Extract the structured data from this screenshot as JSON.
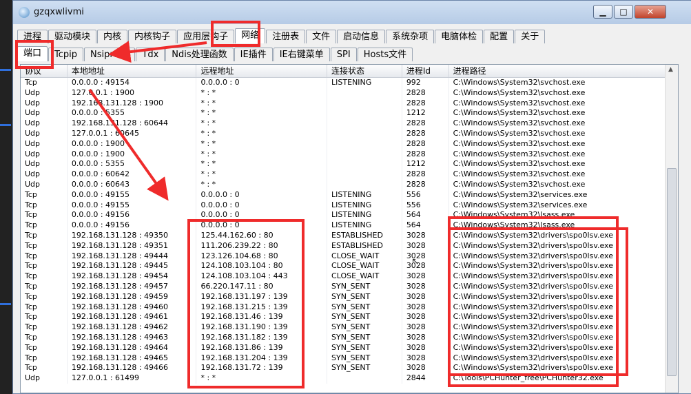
{
  "window": {
    "title": "gzqxwlivmi",
    "minimize_label": "▁",
    "maximize_label": "□",
    "close_label": "✕"
  },
  "tabs_main": [
    "进程",
    "驱动模块",
    "内核",
    "内核钩子",
    "应用层钩子",
    "网络",
    "注册表",
    "文件",
    "启动信息",
    "系统杂项",
    "电脑体检",
    "配置",
    "关于"
  ],
  "tabs_sub": [
    "端口",
    "Tcpip",
    "Nsiproxy",
    "Tdx",
    "Ndis处理函数",
    "IE插件",
    "IE右键菜单",
    "SPI",
    "Hosts文件"
  ],
  "columns": [
    "协议",
    "本地地址",
    "远程地址",
    "连接状态",
    "进程Id",
    "进程路径"
  ],
  "rows": [
    [
      "Tcp",
      "0.0.0.0 : 49154",
      "0.0.0.0 : 0",
      "LISTENING",
      "992",
      "C:\\Windows\\System32\\svchost.exe"
    ],
    [
      "Udp",
      "127.0.0.1 : 1900",
      "* : *",
      "",
      "2828",
      "C:\\Windows\\System32\\svchost.exe"
    ],
    [
      "Udp",
      "192.168.131.128 : 1900",
      "* : *",
      "",
      "2828",
      "C:\\Windows\\System32\\svchost.exe"
    ],
    [
      "Udp",
      "0.0.0.0 : 5355",
      "* : *",
      "",
      "1212",
      "C:\\Windows\\System32\\svchost.exe"
    ],
    [
      "Udp",
      "192.168.131.128 : 60644",
      "* : *",
      "",
      "2828",
      "C:\\Windows\\System32\\svchost.exe"
    ],
    [
      "Udp",
      "127.0.0.1 : 60645",
      "* : *",
      "",
      "2828",
      "C:\\Windows\\System32\\svchost.exe"
    ],
    [
      "Udp",
      "0.0.0.0 : 1900",
      "* : *",
      "",
      "2828",
      "C:\\Windows\\System32\\svchost.exe"
    ],
    [
      "Udp",
      "0.0.0.0 : 1900",
      "* : *",
      "",
      "2828",
      "C:\\Windows\\System32\\svchost.exe"
    ],
    [
      "Udp",
      "0.0.0.0 : 5355",
      "* : *",
      "",
      "1212",
      "C:\\Windows\\System32\\svchost.exe"
    ],
    [
      "Udp",
      "0.0.0.0 : 60642",
      "* : *",
      "",
      "2828",
      "C:\\Windows\\System32\\svchost.exe"
    ],
    [
      "Udp",
      "0.0.0.0 : 60643",
      "* : *",
      "",
      "2828",
      "C:\\Windows\\System32\\svchost.exe"
    ],
    [
      "Tcp",
      "0.0.0.0 : 49155",
      "0.0.0.0 : 0",
      "LISTENING",
      "556",
      "C:\\Windows\\System32\\services.exe"
    ],
    [
      "Tcp",
      "0.0.0.0 : 49155",
      "0.0.0.0 : 0",
      "LISTENING",
      "556",
      "C:\\Windows\\System32\\services.exe"
    ],
    [
      "Tcp",
      "0.0.0.0 : 49156",
      "0.0.0.0 : 0",
      "LISTENING",
      "564",
      "C:\\Windows\\System32\\lsass.exe"
    ],
    [
      "Tcp",
      "0.0.0.0 : 49156",
      "0.0.0.0 : 0",
      "LISTENING",
      "564",
      "C:\\Windows\\System32\\lsass.exe"
    ],
    [
      "Tcp",
      "192.168.131.128 : 49350",
      "125.44.162.60 : 80",
      "ESTABLISHED",
      "3028",
      "C:\\Windows\\System32\\drivers\\spo0lsv.exe"
    ],
    [
      "Tcp",
      "192.168.131.128 : 49351",
      "111.206.239.22 : 80",
      "ESTABLISHED",
      "3028",
      "C:\\Windows\\System32\\drivers\\spo0lsv.exe"
    ],
    [
      "Tcp",
      "192.168.131.128 : 49444",
      "123.126.104.68 : 80",
      "CLOSE_WAIT",
      "3028",
      "C:\\Windows\\System32\\drivers\\spo0lsv.exe"
    ],
    [
      "Tcp",
      "192.168.131.128 : 49445",
      "124.108.103.104 : 80",
      "CLOSE_WAIT",
      "3028",
      "C:\\Windows\\System32\\drivers\\spo0lsv.exe"
    ],
    [
      "Tcp",
      "192.168.131.128 : 49454",
      "124.108.103.104 : 443",
      "CLOSE_WAIT",
      "3028",
      "C:\\Windows\\System32\\drivers\\spo0lsv.exe"
    ],
    [
      "Tcp",
      "192.168.131.128 : 49457",
      "66.220.147.11 : 80",
      "SYN_SENT",
      "3028",
      "C:\\Windows\\System32\\drivers\\spo0lsv.exe"
    ],
    [
      "Tcp",
      "192.168.131.128 : 49459",
      "192.168.131.197 : 139",
      "SYN_SENT",
      "3028",
      "C:\\Windows\\System32\\drivers\\spo0lsv.exe"
    ],
    [
      "Tcp",
      "192.168.131.128 : 49460",
      "192.168.131.215 : 139",
      "SYN_SENT",
      "3028",
      "C:\\Windows\\System32\\drivers\\spo0lsv.exe"
    ],
    [
      "Tcp",
      "192.168.131.128 : 49461",
      "192.168.131.46 : 139",
      "SYN_SENT",
      "3028",
      "C:\\Windows\\System32\\drivers\\spo0lsv.exe"
    ],
    [
      "Tcp",
      "192.168.131.128 : 49462",
      "192.168.131.190 : 139",
      "SYN_SENT",
      "3028",
      "C:\\Windows\\System32\\drivers\\spo0lsv.exe"
    ],
    [
      "Tcp",
      "192.168.131.128 : 49463",
      "192.168.131.182 : 139",
      "SYN_SENT",
      "3028",
      "C:\\Windows\\System32\\drivers\\spo0lsv.exe"
    ],
    [
      "Tcp",
      "192.168.131.128 : 49464",
      "192.168.131.86 : 139",
      "SYN_SENT",
      "3028",
      "C:\\Windows\\System32\\drivers\\spo0lsv.exe"
    ],
    [
      "Tcp",
      "192.168.131.128 : 49465",
      "192.168.131.204 : 139",
      "SYN_SENT",
      "3028",
      "C:\\Windows\\System32\\drivers\\spo0lsv.exe"
    ],
    [
      "Tcp",
      "192.168.131.128 : 49466",
      "192.168.131.72 : 139",
      "SYN_SENT",
      "3028",
      "C:\\Windows\\System32\\drivers\\spo0lsv.exe"
    ],
    [
      "Udp",
      "127.0.0.1 : 61499",
      "* : *",
      "",
      "2844",
      "C:\\Tools\\PCHunter_free\\PCHunter32.exe"
    ]
  ],
  "annotation_color": "#ef2b2b",
  "icons": {
    "app": "shield-app-icon",
    "cursor": "mouse-cursor-icon"
  }
}
